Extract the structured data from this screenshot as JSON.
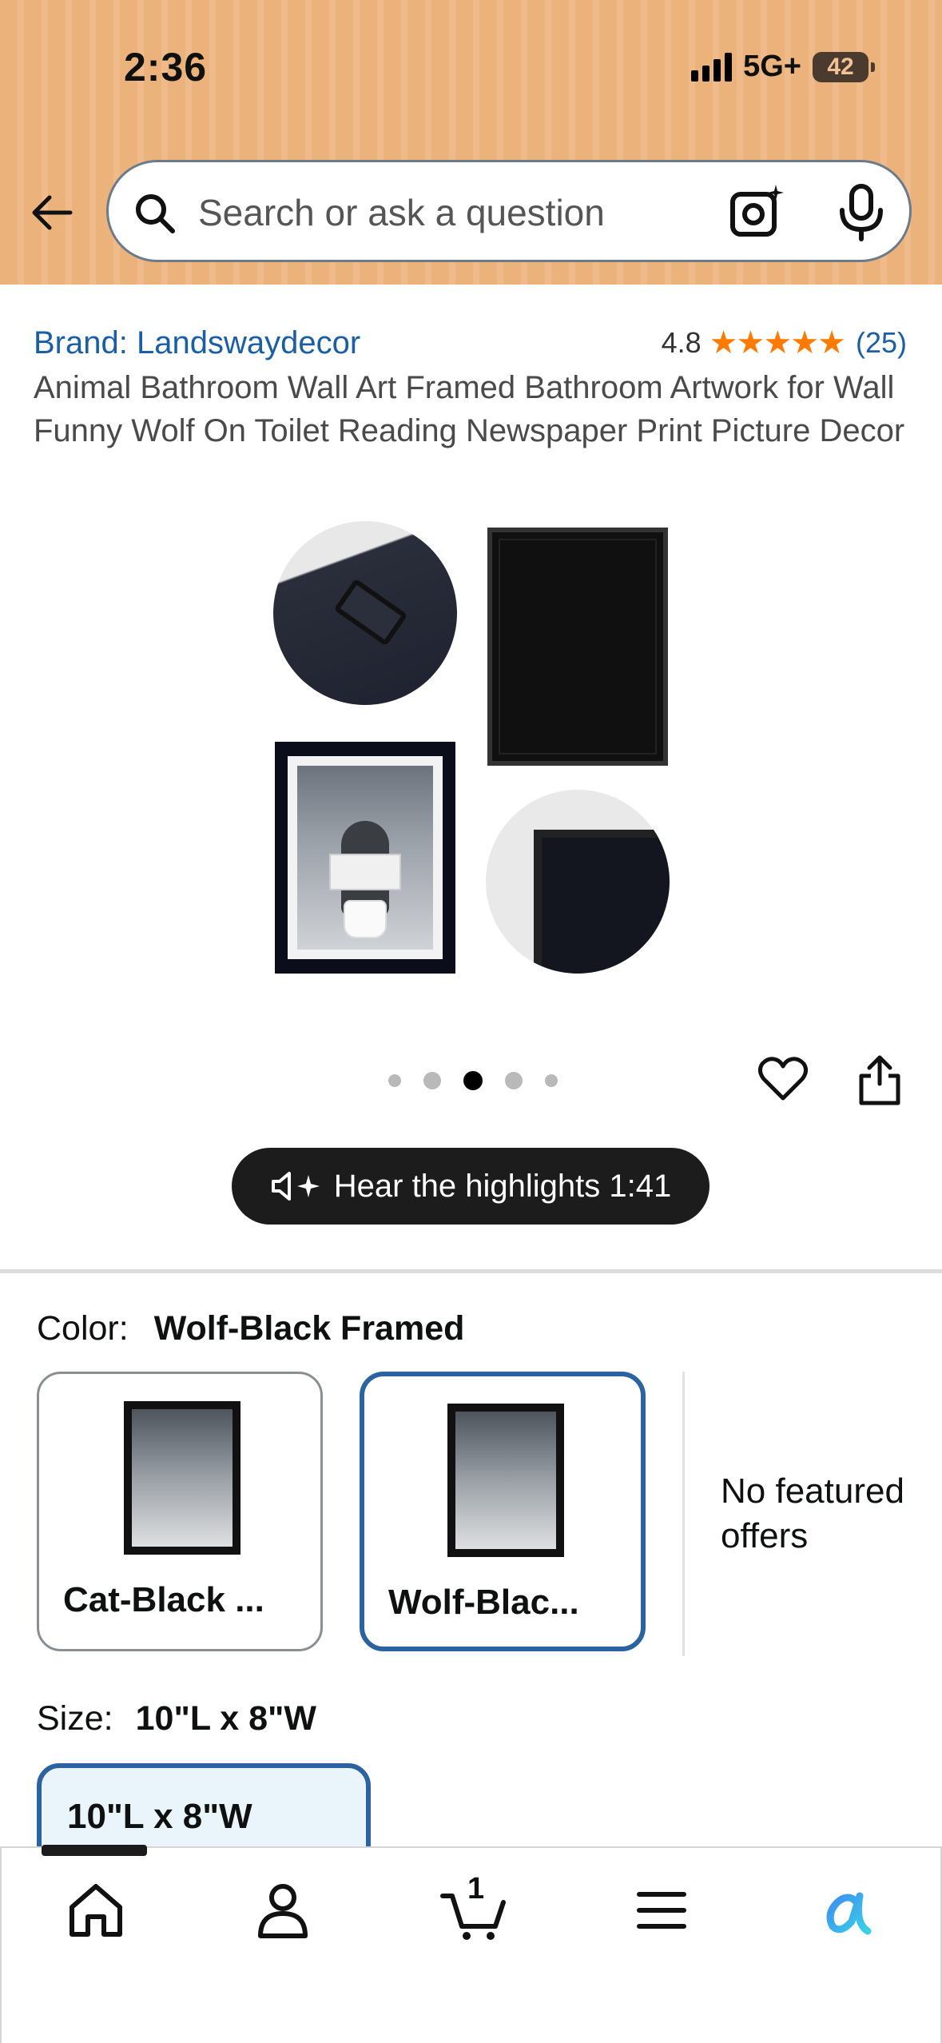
{
  "status_bar": {
    "time": "2:36",
    "network": "5G+",
    "battery": "42"
  },
  "search": {
    "placeholder": "Search or ask a question"
  },
  "product": {
    "brand": "Brand: Landswaydecor",
    "rating": "4.8",
    "stars": 5,
    "review_count": "(25)",
    "title": "Animal Bathroom Wall Art Framed Bathroom Artwork for Wall Funny Wolf On Toilet Reading Newspaper Print Picture Decor"
  },
  "gallery": {
    "dot_count": 5,
    "active_index": 2
  },
  "audio": {
    "label": "Hear the highlights 1:41"
  },
  "color": {
    "label": "Color:",
    "value": "Wolf-Black Framed",
    "options": [
      {
        "label": "Cat-Black ...",
        "selected": false
      },
      {
        "label": "Wolf-Blac...",
        "selected": true
      }
    ],
    "no_offers": "No featured offers"
  },
  "size": {
    "label": "Size:",
    "value": "10\"L x 8\"W",
    "chip": "10\"L x 8\"W"
  },
  "nav": {
    "cart_count": "1"
  },
  "colors": {
    "header": "#ecb27c",
    "link": "#1a5fa5",
    "star": "#ff7a00",
    "selected_border": "#2a63a0"
  }
}
